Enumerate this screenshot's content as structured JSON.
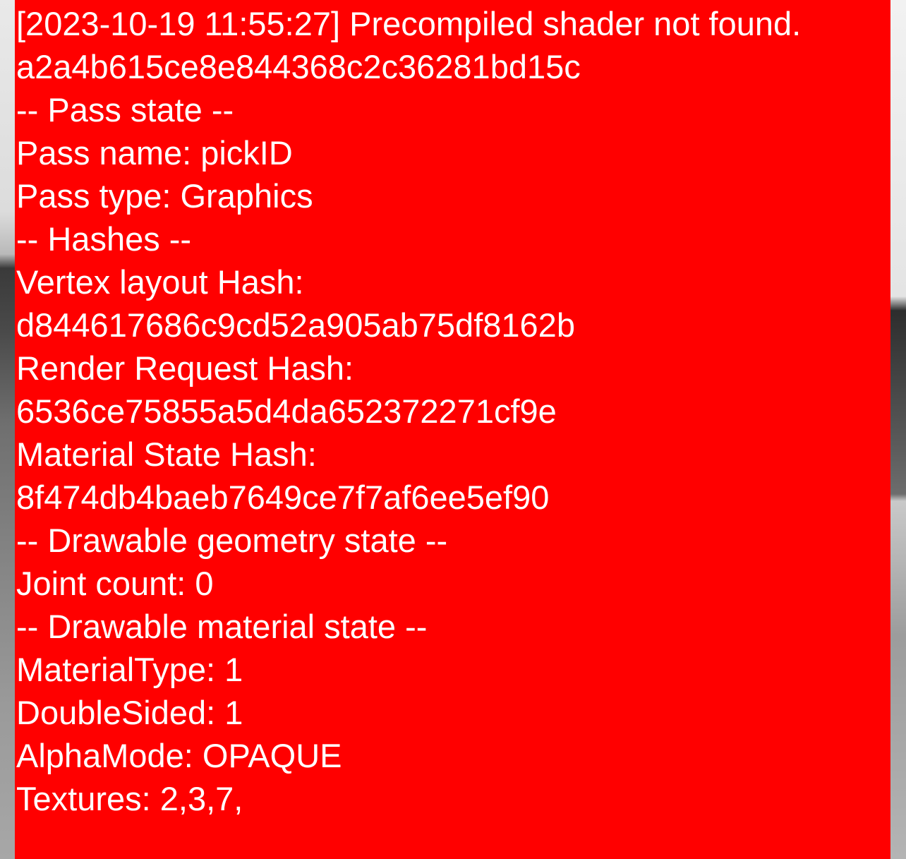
{
  "colors": {
    "overlay_background": "#ff0000",
    "text": "#ffffff"
  },
  "log": {
    "lines": [
      "[2023-10-19 11:55:27] Precompiled shader not found.",
      "a2a4b615ce8e844368c2c36281bd15c",
      "-- Pass state --",
      "Pass name: pickID",
      "Pass type: Graphics",
      "-- Hashes --",
      "Vertex layout Hash:",
      "d844617686c9cd52a905ab75df8162b",
      "Render Request Hash:",
      "6536ce75855a5d4da652372271cf9e",
      "Material State Hash:",
      "8f474db4baeb7649ce7f7af6ee5ef90",
      "-- Drawable geometry state --",
      "Joint count: 0",
      "-- Drawable material state --",
      "MaterialType: 1",
      "DoubleSided: 1",
      "AlphaMode: OPAQUE",
      "Textures: 2,3,7,"
    ]
  }
}
